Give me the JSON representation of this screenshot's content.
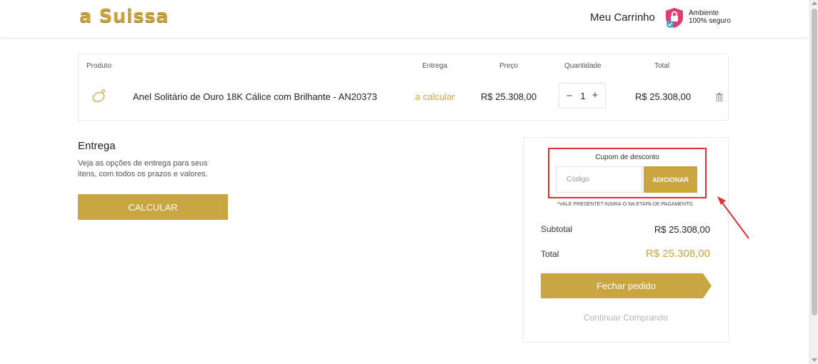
{
  "header": {
    "logo": "a Suissa",
    "cart_link": "Meu Carrinho",
    "secure_line1": "Ambiente",
    "secure_line2": "100% seguro",
    "secure_icon": "shield-lock-icon"
  },
  "cart": {
    "columns": {
      "product": "Produto",
      "delivery": "Entrega",
      "price": "Preço",
      "quantity": "Quantidade",
      "total": "Total"
    },
    "item": {
      "image_icon": "ring-icon",
      "name": "Anel Solitário de Ouro 18K Cálice com Brilhante - AN20373",
      "delivery": "a calcular",
      "price": "R$ 25.308,00",
      "quantity_minus": "−",
      "quantity": "1",
      "quantity_plus": "+",
      "total": "R$ 25.308,00",
      "remove_icon": "trash-icon"
    }
  },
  "delivery": {
    "title": "Entrega",
    "description": "Veja as opções de entrega para seus itens, com todos os prazos e valores.",
    "calculate_button": "CALCULAR"
  },
  "summary": {
    "coupon_title": "Cupom de desconto",
    "coupon_placeholder": "Código",
    "coupon_button": "ADICIONAR",
    "gift_note": "*VALE PRESENTE? INSIRA-O NA ETAPA DE PAGAMENTO.",
    "subtotal_label": "Subtotal",
    "subtotal_value": "R$ 25.308,00",
    "total_label": "Total",
    "total_value": "R$ 25.308,00",
    "checkout_button": "Fechar pedido",
    "continue_link": "Continuar Comprando"
  },
  "colors": {
    "accent": "#c9a43f",
    "highlight": "#e03131"
  }
}
